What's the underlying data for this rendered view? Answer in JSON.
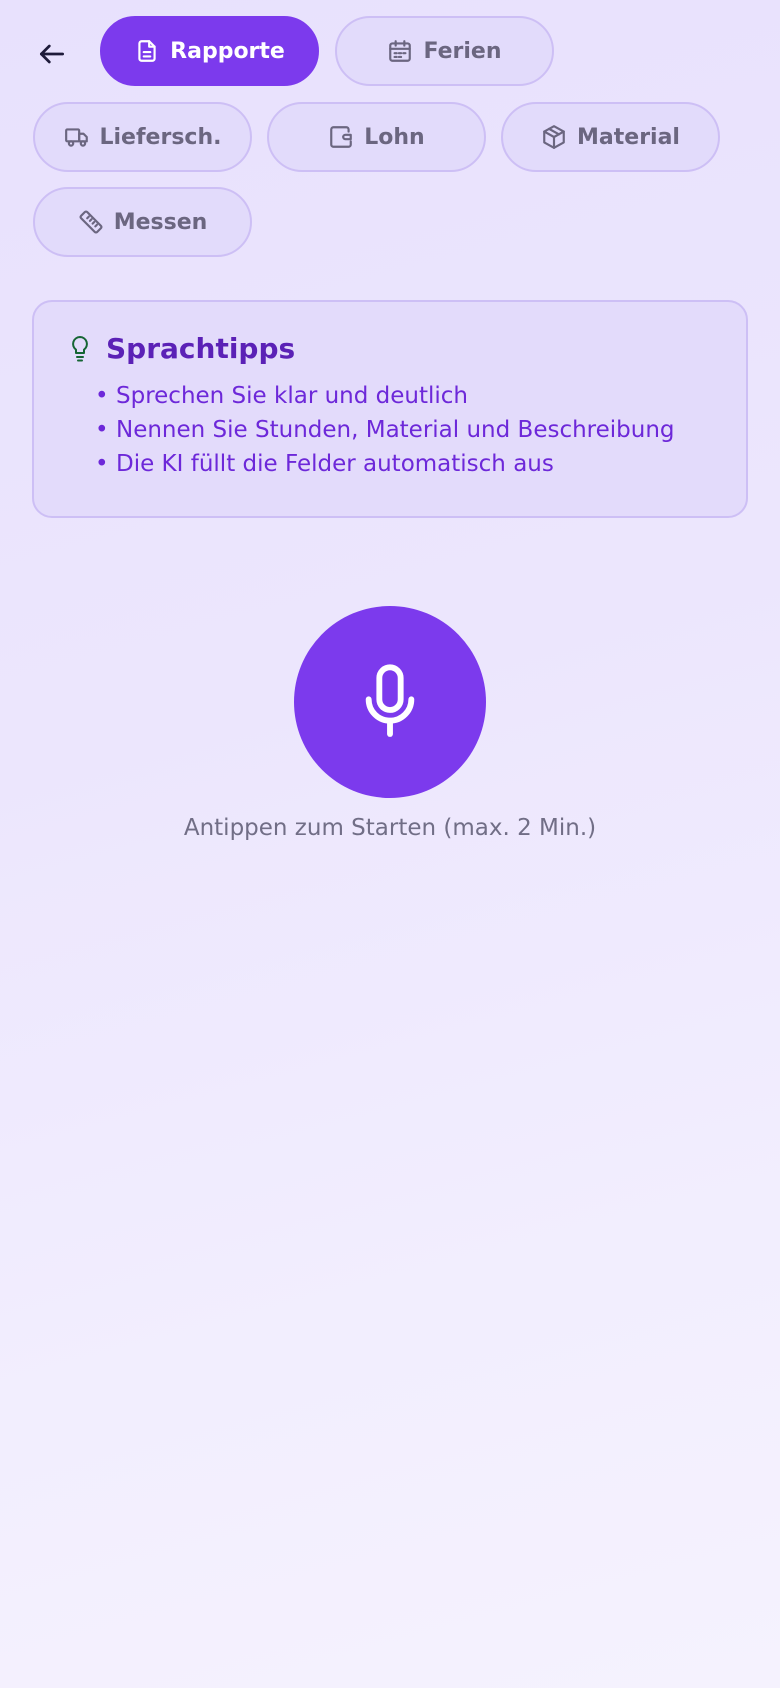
{
  "nav": {
    "back_icon": "arrow-left-icon"
  },
  "tabs": [
    {
      "label": "Rapporte",
      "icon": "document-icon",
      "active": true
    },
    {
      "label": "Ferien",
      "icon": "calendar-icon",
      "active": false
    },
    {
      "label": "Liefersch.",
      "icon": "truck-icon",
      "active": false
    },
    {
      "label": "Lohn",
      "icon": "wallet-icon",
      "active": false
    },
    {
      "label": "Material",
      "icon": "box-icon",
      "active": false
    },
    {
      "label": "Messen",
      "icon": "ruler-icon",
      "active": false
    }
  ],
  "tips": {
    "icon": "lightbulb-icon",
    "title": "Sprachtipps",
    "items": [
      "Sprechen Sie klar und deutlich",
      "Nennen Sie Stunden, Material und Beschreibung",
      "Die KI füllt die Felder automatisch aus"
    ]
  },
  "recorder": {
    "icon": "microphone-icon",
    "hint": "Antippen zum Starten (max. 2 Min.)"
  },
  "colors": {
    "accent": "#7c3aed",
    "tip_title": "#5b21b6",
    "tip_text": "#6d28d9",
    "chip_bg": "#e2dbfb",
    "chip_text": "#6b6680"
  }
}
